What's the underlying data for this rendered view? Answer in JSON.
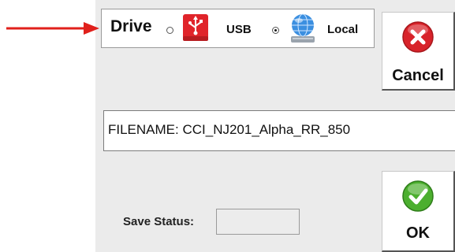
{
  "drive": {
    "label": "Drive",
    "options": [
      {
        "label": "USB",
        "icon": "usb-drive-icon",
        "selected": false
      },
      {
        "label": "Local",
        "icon": "local-disk-globe-icon",
        "selected": true
      }
    ]
  },
  "buttons": {
    "cancel_label": "Cancel",
    "ok_label": "OK"
  },
  "file": {
    "filename": "FILENAME: CCI_NJ201_Alpha_RR_850"
  },
  "status": {
    "label": "Save Status:",
    "value": ""
  },
  "colors": {
    "annotation_arrow": "#e0201b",
    "usb_icon": "#e0242a",
    "cancel_icon": "#d8232a",
    "ok_icon": "#4caf2f",
    "panel_background": "#ebebeb"
  }
}
